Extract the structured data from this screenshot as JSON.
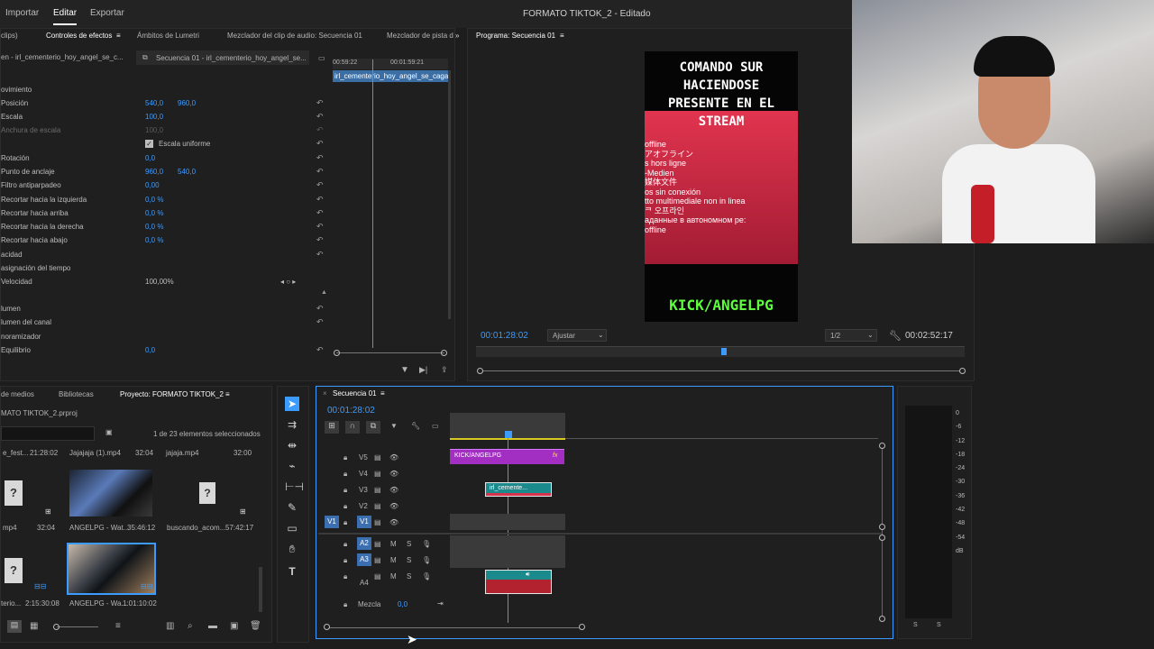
{
  "menu": {
    "importar": "Importar",
    "editar": "Editar",
    "exportar": "Exportar"
  },
  "window_title": "FORMATO TIKTOK_2 - Editado",
  "effects_tabs": {
    "clips": "clips)",
    "controles": "Controles de efectos",
    "lumetri": "Ámbitos de Lumetri",
    "mezclador": "Mezclador del clip de audio: Secuencia 01",
    "pista": "Mezclador de pista d"
  },
  "clip_source": "en - irl_cementerio_hoy_angel_se_c...",
  "clip_seq": "Secuencia 01 - irl_cementerio_hoy_angel_se...",
  "mini_timeline": {
    "t1": "00:59:22",
    "t2": "00:01:59:21",
    "clip": "irl_cementerio_hoy_angel_se_caga"
  },
  "effects": {
    "movimiento": "ovimiento",
    "posicion": "Posición",
    "posicion_x": "540,0",
    "posicion_y": "960,0",
    "escala": "Escala",
    "escala_v": "100,0",
    "anchura": "Anchura de escala",
    "anchura_v": "100,0",
    "uniforme": "Escala uniforme",
    "rotacion": "Rotación",
    "rotacion_v": "0,0",
    "anclaje": "Punto de anclaje",
    "anclaje_x": "960,0",
    "anclaje_y": "540,0",
    "filtro": "Filtro antiparpadeo",
    "filtro_v": "0,00",
    "rec_izq": "Recortar hacia la izquierda",
    "rec_izq_v": "0,0 %",
    "rec_arriba": "Recortar hacia arriba",
    "rec_arriba_v": "0,0 %",
    "rec_der": "Recortar hacia la derecha",
    "rec_der_v": "0,0 %",
    "rec_abajo": "Recortar hacia abajo",
    "rec_abajo_v": "0,0 %",
    "opacidad": "acidad",
    "reasig": "asignación del tiempo",
    "velocidad": "Velocidad",
    "velocidad_v": "100,00%",
    "volumen": "lumen",
    "vol_canal": "lumen del canal",
    "panorama": "noramizador",
    "equilibrio": "Equilibrio",
    "equilibrio_v": "0,0"
  },
  "program": {
    "title": "Programa: Secuencia 01",
    "headline_l1": "COMANDO SUR",
    "headline_l2": "HACIENDOSE",
    "headline_l3": "PRESENTE EN EL",
    "headline_l4": "STREAM",
    "offline": [
      "offline",
      "アオフライン",
      "s hors ligne",
      "-Medien",
      "媒体文件",
      "os sin conexión",
      "tto multimediale non in linea",
      "ᄏ 오프라인",
      "аданные в автономном ре:",
      "offline"
    ],
    "kick": "KICK/ANGELPG",
    "timecode": "00:01:28:02",
    "fit": "Ajustar",
    "quality": "1/2",
    "duration": "00:02:52:17"
  },
  "project": {
    "tabs": {
      "medios": "de medios",
      "bibliotecas": "Bibliotecas",
      "proyecto": "Proyecto: FORMATO TIKTOK_2"
    },
    "file": "MATO TIKTOK_2.prproj",
    "selected": "1 de 23 elementos seleccionados",
    "items": [
      {
        "name": "e_fest...",
        "dur": "21:28:02"
      },
      {
        "name": "Jajajaja (1).mp4",
        "dur": "32:04"
      },
      {
        "name": "jajaja.mp4",
        "dur": "32:00"
      },
      {
        "name": "mp4",
        "dur": "32:04"
      },
      {
        "name": "ANGELPG - Wat...",
        "dur": "35:46:12"
      },
      {
        "name": "buscando_acom...",
        "dur": "57:42:17"
      },
      {
        "name": "terio...",
        "dur": "2:15:30:08"
      },
      {
        "name": "ANGELPG - Wa...",
        "dur": "1:01:10:02"
      }
    ]
  },
  "timeline": {
    "title": "Secuencia 01",
    "timecode": "00:01:28:02",
    "tracks": {
      "v5": "V5",
      "v4": "V4",
      "v3": "V3",
      "v2": "V2",
      "v1": "V1",
      "v1src": "V1",
      "a2": "A2",
      "a3": "A3",
      "a4": "A4",
      "mezcla": "Mezcla",
      "mezcla_v": "0,0",
      "m": "M",
      "s": "S"
    },
    "clip_kick": "KICK/ANGELPG",
    "clip_fx": "fx",
    "clip_irl": "irl_cemente..."
  },
  "meter": {
    "ticks": [
      "0",
      "-6",
      "-12",
      "-18",
      "-24",
      "-30",
      "-36",
      "-42",
      "-48",
      "-54",
      "dB"
    ],
    "s1": "S",
    "s2": "S"
  },
  "colors": {
    "accent": "#3c9bff",
    "clip_purple": "#a22fc2",
    "clip_teal": "#1b8a8c",
    "kick_green": "#5dff3d",
    "red": "#d6324c"
  }
}
